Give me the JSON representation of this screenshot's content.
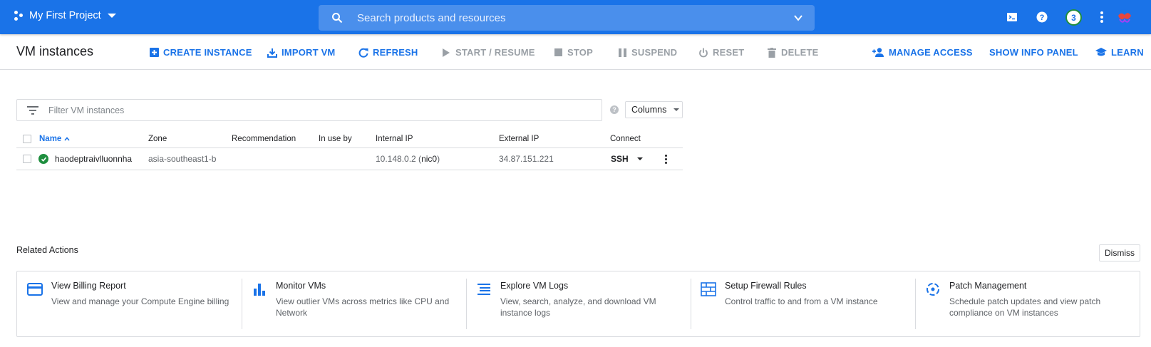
{
  "topbar": {
    "project_name": "My First Project",
    "search_placeholder": "Search products and resources",
    "notification_count": "3"
  },
  "toolbar": {
    "title": "VM instances",
    "buttons": [
      {
        "label": "CREATE INSTANCE",
        "icon": "add-box-icon",
        "enabled": true
      },
      {
        "label": "IMPORT VM",
        "icon": "download-icon",
        "enabled": true
      },
      {
        "label": "REFRESH",
        "icon": "refresh-icon",
        "enabled": true
      },
      {
        "label": "START / RESUME",
        "icon": "play-icon",
        "enabled": false
      },
      {
        "label": "STOP",
        "icon": "stop-icon",
        "enabled": false
      },
      {
        "label": "SUSPEND",
        "icon": "pause-icon",
        "enabled": false
      },
      {
        "label": "RESET",
        "icon": "power-icon",
        "enabled": false
      },
      {
        "label": "DELETE",
        "icon": "trash-icon",
        "enabled": false
      }
    ],
    "right_buttons": [
      {
        "label": "MANAGE ACCESS",
        "icon": "person-add-icon"
      },
      {
        "label": "SHOW INFO PANEL",
        "icon": ""
      },
      {
        "label": "LEARN",
        "icon": "school-icon"
      }
    ]
  },
  "filter": {
    "placeholder": "Filter VM instances",
    "columns_label": "Columns"
  },
  "table": {
    "headers": [
      "Name",
      "Zone",
      "Recommendation",
      "In use by",
      "Internal IP",
      "External IP",
      "Connect"
    ],
    "rows": [
      {
        "name": "haodeptraivlluonnha",
        "zone": "asia-southeast1-b",
        "recommendation": "",
        "in_use_by": "",
        "internal_ip": "10.148.0.2",
        "internal_nic": "nic0",
        "external_ip": "34.87.151.221",
        "connect": "SSH",
        "status": "running"
      }
    ]
  },
  "related": {
    "title": "Related Actions",
    "dismiss_label": "Dismiss",
    "cards": [
      {
        "title": "View Billing Report",
        "desc": "View and manage your Compute Engine billing",
        "icon": "credit-card-icon"
      },
      {
        "title": "Monitor VMs",
        "desc": "View outlier VMs across metrics like CPU and Network",
        "icon": "bar-chart-icon"
      },
      {
        "title": "Explore VM Logs",
        "desc": "View, search, analyze, and download VM instance logs",
        "icon": "logs-icon"
      },
      {
        "title": "Setup Firewall Rules",
        "desc": "Control traffic to and from a VM instance",
        "icon": "firewall-icon"
      },
      {
        "title": "Patch Management",
        "desc": "Schedule patch updates and view patch compliance on VM instances",
        "icon": "patch-icon"
      }
    ]
  },
  "colors": {
    "brand_blue": "#1a73e8",
    "status_green": "#1e8e3e",
    "disabled_gray": "#9aa0a6"
  }
}
